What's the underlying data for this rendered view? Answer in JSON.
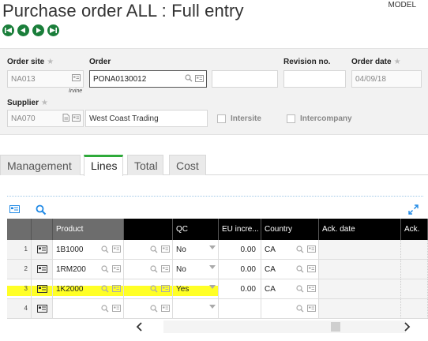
{
  "header": {
    "title": "Purchase order ALL : Full entry",
    "model": "MODEL"
  },
  "nav": [
    "first-record-icon",
    "previous-record-icon",
    "next-record-icon",
    "last-record-icon"
  ],
  "form": {
    "order_site": {
      "label": "Order site",
      "value": "NA013",
      "subtext": "Irvine"
    },
    "order": {
      "label": "Order",
      "value": "PONA0130012",
      "extra_value": ""
    },
    "revision": {
      "label": "Revision no.",
      "value": ""
    },
    "order_date": {
      "label": "Order date",
      "value": "04/09/18"
    },
    "supplier": {
      "label": "Supplier",
      "value": "NA070",
      "name": "West Coast Trading"
    },
    "intersite": {
      "label": "Intersite",
      "checked": false
    },
    "intercompany": {
      "label": "Intercompany",
      "checked": false
    }
  },
  "tabs": [
    {
      "label": "Management",
      "active": false
    },
    {
      "label": "Lines",
      "active": true
    },
    {
      "label": "Total",
      "active": false
    },
    {
      "label": "Cost",
      "active": false
    }
  ],
  "grid": {
    "columns": {
      "product": "Product",
      "blank": "",
      "qc": "QC",
      "eu": "EU incre...",
      "country": "Country",
      "ack_date": "Ack. date",
      "ack": "Ack. "
    },
    "rows": [
      {
        "no": "1",
        "product": "1B1000",
        "qc": "No",
        "eu": "0.00",
        "country": "CA"
      },
      {
        "no": "2",
        "product": "1RM200",
        "qc": "No",
        "eu": "0.00",
        "country": "CA"
      },
      {
        "no": "3",
        "product": "1K2000",
        "qc": "Yes",
        "eu": "0.00",
        "country": "CA"
      },
      {
        "no": "4",
        "product": "",
        "qc": "",
        "eu": "",
        "country": ""
      }
    ],
    "highlighted_row": 3
  },
  "colors": {
    "accent_green": "#2eaa3a",
    "nav_green": "#1a7e3a",
    "highlight": "#ffff00",
    "link_blue": "#1e88e5"
  }
}
